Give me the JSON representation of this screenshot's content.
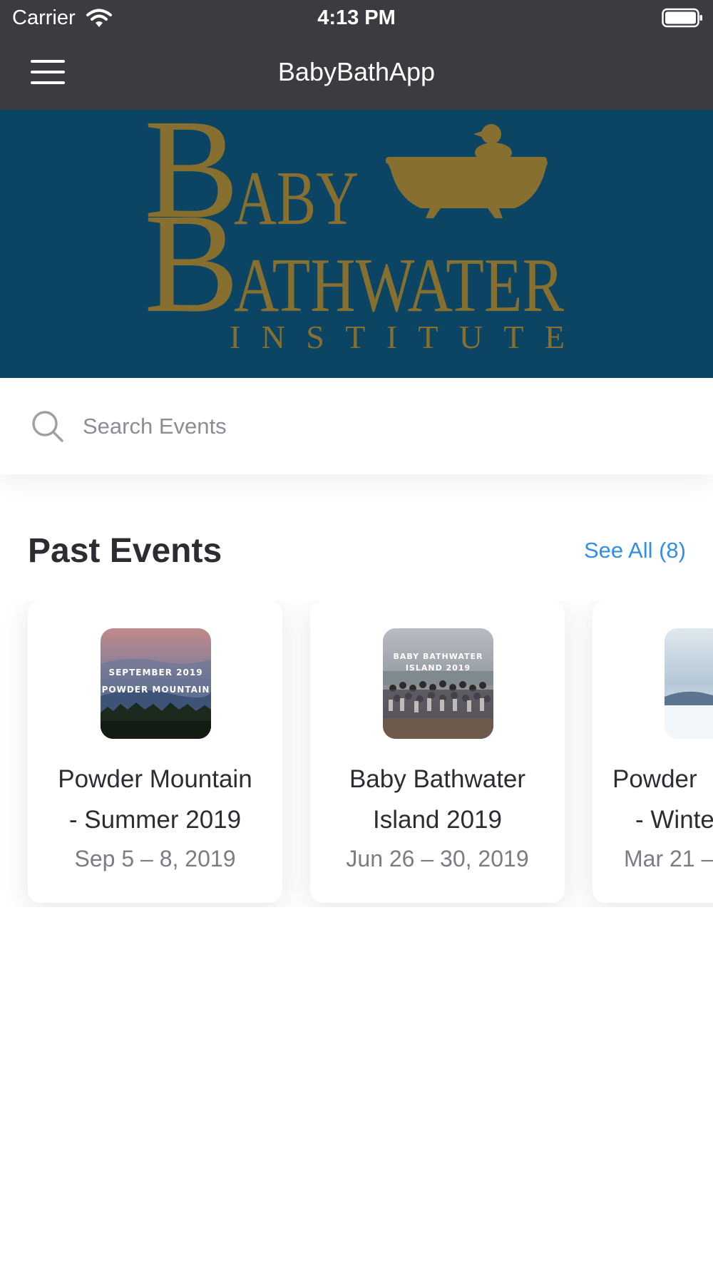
{
  "status_bar": {
    "carrier": "Carrier",
    "time": "4:13 PM",
    "icons": [
      "wifi-icon",
      "battery-icon"
    ]
  },
  "nav": {
    "menu_icon": "hamburger-menu-icon",
    "title": "BabyBathApp"
  },
  "banner": {
    "logo_line1_rest": "ABY",
    "logo_line2_rest": "ATHWATER",
    "logo_initial": "B",
    "logo_subtitle": "INSTITUTE",
    "logo_icon": "bathtub-duck-icon"
  },
  "search": {
    "placeholder": "Search Events",
    "value": ""
  },
  "past_events": {
    "title": "Past Events",
    "see_all": "See All (8)",
    "events": [
      {
        "title_line1": "Powder Mountain",
        "title_line2": "- Summer 2019",
        "date": "Sep 5 – 8, 2019",
        "thumb_text_line1": "SEPTEMBER 2019",
        "thumb_text_line2": "POWDER MOUNTAIN"
      },
      {
        "title_line1": "Baby Bathwater",
        "title_line2": "Island 2019",
        "date": "Jun 26 – 30, 2019",
        "thumb_text_line1": "BABY BATHWATER",
        "thumb_text_line2": "ISLAND 2019"
      },
      {
        "title_line1": "Powder",
        "title_line2": "- Winte",
        "date": "Mar 21 –"
      }
    ]
  },
  "colors": {
    "nav_bg": "#3a3c3f",
    "banner_bg": "#0c4563",
    "logo_gold": "#87702f",
    "accent_blue": "#2f8fe6"
  }
}
